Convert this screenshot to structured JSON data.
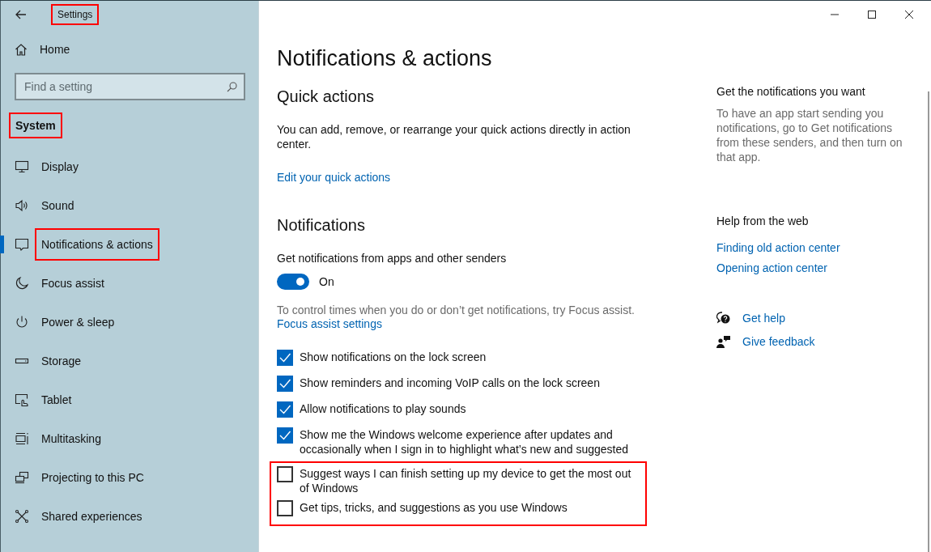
{
  "window": {
    "title": "Settings",
    "title_highlighted": true
  },
  "sidebar": {
    "home": "Home",
    "search": {
      "placeholder": "Find a setting"
    },
    "section": "System",
    "section_highlighted": true,
    "items": [
      {
        "label": "Display",
        "kind": "display",
        "selected": false,
        "highlighted": false
      },
      {
        "label": "Sound",
        "kind": "sound",
        "selected": false,
        "highlighted": false
      },
      {
        "label": "Notifications & actions",
        "kind": "notifications",
        "selected": true,
        "highlighted": true
      },
      {
        "label": "Focus assist",
        "kind": "focus",
        "selected": false,
        "highlighted": false
      },
      {
        "label": "Power & sleep",
        "kind": "power",
        "selected": false,
        "highlighted": false
      },
      {
        "label": "Storage",
        "kind": "storage",
        "selected": false,
        "highlighted": false
      },
      {
        "label": "Tablet",
        "kind": "tablet",
        "selected": false,
        "highlighted": false
      },
      {
        "label": "Multitasking",
        "kind": "multitasking",
        "selected": false,
        "highlighted": false
      },
      {
        "label": "Projecting to this PC",
        "kind": "projecting",
        "selected": false,
        "highlighted": false
      },
      {
        "label": "Shared experiences",
        "kind": "shared",
        "selected": false,
        "highlighted": false
      }
    ]
  },
  "page": {
    "title": "Notifications & actions",
    "quick_actions": {
      "heading": "Quick actions",
      "text": "You can add, remove, or rearrange your quick actions directly in action center.",
      "link": "Edit your quick actions"
    },
    "notifications": {
      "heading": "Notifications",
      "toggle_label": "Get notifications from apps and other senders",
      "toggle": {
        "on": true,
        "text": "On"
      },
      "hint": "To control times when you do or don’t get notifications, try Focus assist.",
      "hint_link": "Focus assist settings",
      "checkbox_groups": [
        {
          "highlighted": false,
          "items": [
            {
              "label": "Show notifications on the lock screen",
              "checked": true
            },
            {
              "label": "Show reminders and incoming VoIP calls on the lock screen",
              "checked": true
            },
            {
              "label": "Allow notifications to play sounds",
              "checked": true
            },
            {
              "label": "Show me the Windows welcome experience after updates and occasionally when I sign in to highlight what’s new and suggested",
              "checked": true
            }
          ]
        },
        {
          "highlighted": true,
          "items": [
            {
              "label": "Suggest ways I can finish setting up my device to get the most out of Windows",
              "checked": false
            },
            {
              "label": "Get tips, tricks, and suggestions as you use Windows",
              "checked": false
            }
          ]
        }
      ]
    }
  },
  "side_panel": {
    "info_heading": "Get the notifications you want",
    "info_text": "To have an app start sending you notifications, go to Get notifications from these senders, and then turn on that app.",
    "web_heading": "Help from the web",
    "web_links": [
      "Finding old action center",
      "Opening action center"
    ],
    "actions": [
      {
        "kind": "help",
        "label": "Get help"
      },
      {
        "kind": "feedback",
        "label": "Give feedback"
      }
    ]
  }
}
